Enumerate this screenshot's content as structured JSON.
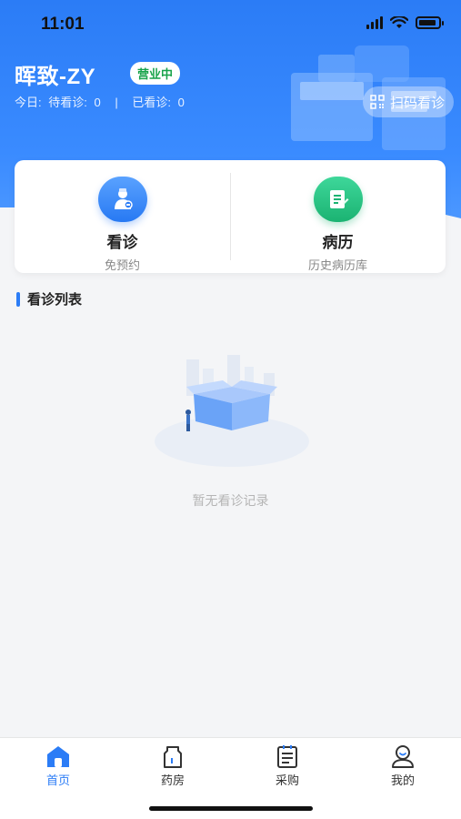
{
  "status_bar": {
    "time": "11:01"
  },
  "header": {
    "clinic_name": "晖致-ZY",
    "status_badge": "营业中",
    "today_label": "今日:",
    "pending_label": "待看诊:",
    "pending_count": "0",
    "separator": "|",
    "done_label": "已看诊:",
    "done_count": "0",
    "scan_button": "扫码看诊"
  },
  "actions": [
    {
      "title": "看诊",
      "subtitle": "免预约",
      "icon": "doctor-icon",
      "color": "#2b7cf6"
    },
    {
      "title": "病历",
      "subtitle": "历史病历库",
      "icon": "medical-record-icon",
      "color": "#1bb372"
    }
  ],
  "section": {
    "title": "看诊列表"
  },
  "empty_state": {
    "text": "暂无看诊记录"
  },
  "tab_bar": {
    "tabs": [
      {
        "label": "首页",
        "icon": "home-icon",
        "active": true
      },
      {
        "label": "药房",
        "icon": "pharmacy-icon",
        "active": false
      },
      {
        "label": "采购",
        "icon": "purchase-icon",
        "active": false
      },
      {
        "label": "我的",
        "icon": "profile-icon",
        "active": false
      }
    ]
  },
  "colors": {
    "primary": "#2b7cf6",
    "success": "#18a34a"
  }
}
